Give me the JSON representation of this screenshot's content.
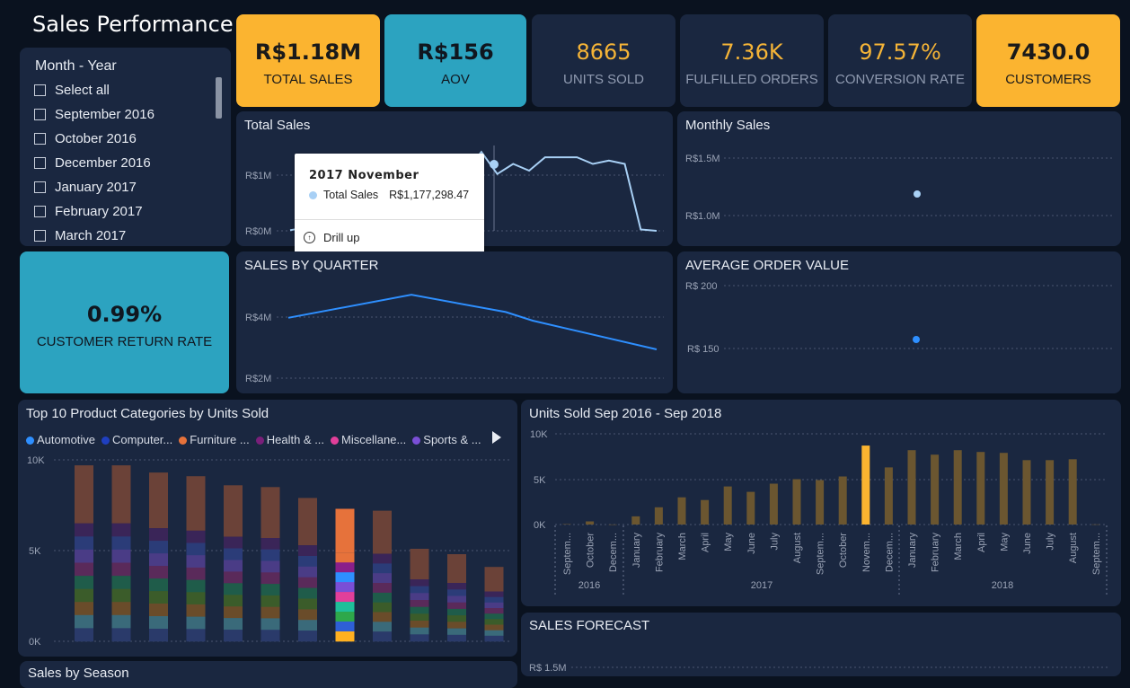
{
  "page_title": "Sales Performance",
  "kpis": [
    {
      "value": "R$1.18M",
      "label": "TOTAL SALES"
    },
    {
      "value": "R$156",
      "label": "AOV"
    },
    {
      "value": "8665",
      "label": "UNITS SOLD"
    },
    {
      "value": "7.36K",
      "label": "FULFILLED ORDERS"
    },
    {
      "value": "97.57%",
      "label": "CONVERSION RATE"
    },
    {
      "value": "7430.0",
      "label": "CUSTOMERS"
    }
  ],
  "return_rate": {
    "value": "0.99%",
    "label": "CUSTOMER RETURN RATE"
  },
  "slicer": {
    "title": "Month - Year",
    "items": [
      "Select all",
      "September 2016",
      "October 2016",
      "December 2016",
      "January 2017",
      "February 2017",
      "March 2017"
    ]
  },
  "total_sales": {
    "title": "Total Sales",
    "yticks": [
      "R$1M",
      "R$0M"
    ]
  },
  "tooltip": {
    "title": "2017 November",
    "series": "Total Sales",
    "value": "R$1,177,298.47",
    "action": "Drill up"
  },
  "monthly_sales": {
    "title": "Monthly Sales",
    "yticks": [
      "R$1.5M",
      "R$1.0M"
    ]
  },
  "quarter": {
    "title": "SALES BY QUARTER",
    "yticks": [
      "R$4M",
      "R$2M"
    ]
  },
  "aov": {
    "title": "AVERAGE ORDER VALUE",
    "yticks": [
      "R$ 200",
      "R$ 150"
    ]
  },
  "top10": {
    "title": "Top 10 Product Categories by Units Sold",
    "legend": [
      {
        "name": "Automotive",
        "color": "#2e8fff"
      },
      {
        "name": "Computer...",
        "color": "#1f3fbf"
      },
      {
        "name": "Furniture ...",
        "color": "#e6723b"
      },
      {
        "name": "Health & ...",
        "color": "#7a1f7a"
      },
      {
        "name": "Miscellane...",
        "color": "#e23f9a"
      },
      {
        "name": "Sports & ...",
        "color": "#7a4fd6"
      }
    ],
    "yticks": [
      "10K",
      "5K",
      "0K"
    ]
  },
  "units": {
    "title": "Units Sold Sep 2016 - Sep 2018",
    "yticks": [
      "10K",
      "5K",
      "0K"
    ],
    "months": [
      "Septem...",
      "October",
      "Decem...",
      "January",
      "February",
      "March",
      "April",
      "May",
      "June",
      "July",
      "August",
      "Septem...",
      "October",
      "Novem...",
      "Decem...",
      "January",
      "February",
      "March",
      "April",
      "May",
      "June",
      "July",
      "August",
      "Septem..."
    ],
    "years": [
      "2016",
      "2017",
      "2018"
    ]
  },
  "forecast": {
    "title": "SALES FORECAST",
    "ytick": "R$ 1.5M"
  },
  "season": {
    "title": "Sales by Season"
  },
  "colors": {
    "accent": "#fbb430",
    "teal": "#2ca3c0",
    "card": "#1a2740",
    "line": "#a8d0f5"
  },
  "chart_data": [
    {
      "type": "line",
      "title": "Total Sales",
      "series": [
        {
          "name": "Total Sales",
          "values": [
            0.01,
            0.05,
            0.1,
            0.2,
            0.3,
            0.4,
            0.5,
            0.6,
            0.7,
            0.78,
            0.85,
            0.88,
            1.18,
            0.85,
            1.0,
            0.9,
            1.1,
            1.1,
            1.1,
            1.0,
            1.05,
            1.0,
            0.02,
            0.0
          ]
        }
      ],
      "ylim": [
        0,
        1.3
      ]
    },
    {
      "type": "line",
      "title": "SALES BY QUARTER",
      "values": [
        4.1,
        4.9,
        4.3,
        4.0,
        3.0
      ],
      "ylim": [
        2,
        5
      ]
    },
    {
      "type": "bar",
      "title": "Units Sold Sep 2016 - Sep 2018",
      "categories": [
        "Septem...",
        "October",
        "Decem...",
        "January",
        "February",
        "March",
        "April",
        "May",
        "June",
        "July",
        "August",
        "Septem...",
        "October",
        "Novem...",
        "Decem...",
        "January",
        "February",
        "March",
        "April",
        "May",
        "June",
        "July",
        "August",
        "Septem..."
      ],
      "values": [
        50,
        350,
        10,
        900,
        1900,
        3000,
        2700,
        4200,
        3600,
        4500,
        5000,
        4900,
        5300,
        8700,
        6300,
        8200,
        7700,
        8200,
        8000,
        7900,
        7100,
        7100,
        7200,
        20
      ],
      "highlight_index": 13,
      "ylim": [
        0,
        10000
      ]
    },
    {
      "type": "bar",
      "title": "Top 10 Product Categories by Units Sold",
      "values": [
        9700,
        9700,
        9300,
        9100,
        8600,
        8500,
        7900,
        7300,
        7200,
        5100,
        4800,
        4100
      ],
      "highlight_index": 7,
      "ylim": [
        0,
        10000
      ]
    }
  ]
}
